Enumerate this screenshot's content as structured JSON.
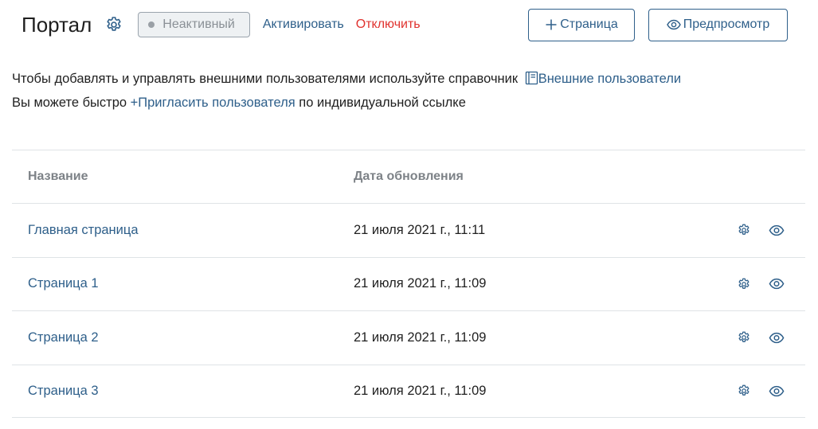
{
  "header": {
    "title": "Портал",
    "status": "Неактивный",
    "activate_link": "Активировать",
    "disable_link": "Отключить",
    "add_page_button": "Страница",
    "preview_button": "Предпросмотр"
  },
  "info": {
    "line1_text": "Чтобы добавлять и управлять внешними пользователями используйте справочник ",
    "line1_link": "Внешние пользователи",
    "line2_text_before": "Вы можете быстро ",
    "line2_link": "+Пригласить пользователя",
    "line2_text_after": " по индивидуальной ссылке"
  },
  "table": {
    "columns": [
      "Название",
      "Дата обновления"
    ],
    "rows": [
      {
        "name": "Главная страница",
        "updated": "21 июля 2021 г., 11:11"
      },
      {
        "name": "Страница 1",
        "updated": "21 июля 2021 г., 11:09"
      },
      {
        "name": "Страница 2",
        "updated": "21 июля 2021 г., 11:09"
      },
      {
        "name": "Страница 3",
        "updated": "21 июля 2021 г., 11:09"
      }
    ]
  },
  "icons": {
    "settings": "gear-icon",
    "preview": "eye-icon",
    "plus": "plus-icon",
    "book": "book-icon"
  },
  "colors": {
    "accent": "#2e5f8a",
    "danger": "#e0322e",
    "muted": "#7d8287"
  }
}
